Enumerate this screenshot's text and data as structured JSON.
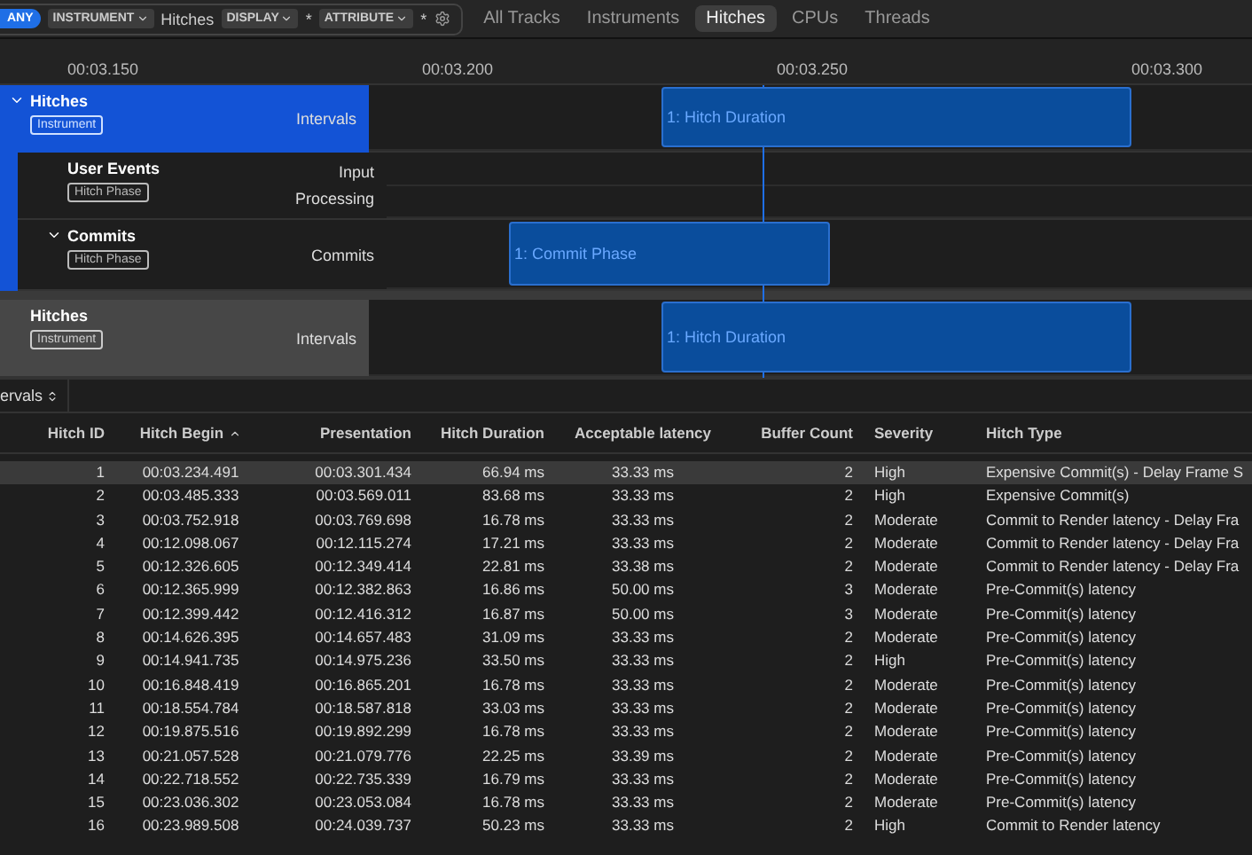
{
  "filter_bar": {
    "any_label": "ANY",
    "tokens": [
      {
        "label": "INSTRUMENT",
        "value": "Hitches"
      },
      {
        "label": "DISPLAY",
        "value": "*"
      },
      {
        "label": "ATTRIBUTE",
        "value": "*"
      }
    ]
  },
  "scope_tabs": [
    {
      "label": "All Tracks",
      "selected": false
    },
    {
      "label": "Instruments",
      "selected": false
    },
    {
      "label": "Hitches",
      "selected": true
    },
    {
      "label": "CPUs",
      "selected": false
    },
    {
      "label": "Threads",
      "selected": false
    }
  ],
  "ruler": {
    "ticks": [
      "00:03.150",
      "00:03.200",
      "00:03.250",
      "00:03.300"
    ]
  },
  "tracks": [
    {
      "name": "Hitches",
      "badge": "Instrument",
      "selected": true,
      "expanded": true,
      "lanes": [
        {
          "label": "Intervals",
          "bars": [
            "1: Hitch Duration"
          ]
        }
      ],
      "children": [
        {
          "name": "User Events",
          "badge": "Hitch Phase",
          "lanes": [
            {
              "label": "Input"
            },
            {
              "label": "Processing"
            }
          ]
        },
        {
          "name": "Commits",
          "badge": "Hitch Phase",
          "expanded": true,
          "lanes": [
            {
              "label": "Commits",
              "bars": [
                "1: Commit Phase"
              ]
            }
          ]
        }
      ]
    },
    {
      "name": "Hitches",
      "badge": "Instrument",
      "selected": false,
      "lanes": [
        {
          "label": "Intervals",
          "bars": [
            "1: Hitch Duration"
          ]
        }
      ]
    }
  ],
  "detail_selector": "ervals",
  "table": {
    "columns": [
      "Hitch ID",
      "Hitch Begin",
      "Presentation",
      "Hitch Duration",
      "Acceptable latency",
      "Buffer Count",
      "Severity",
      "Hitch Type"
    ],
    "rows": [
      {
        "selected": true,
        "cells": [
          "1",
          "00:03.234.491",
          "00:03.301.434",
          "66.94 ms",
          "33.33 ms",
          "2",
          "High",
          "Expensive Commit(s) - Delay Frame S"
        ]
      },
      {
        "selected": false,
        "cells": [
          "2",
          "00:03.485.333",
          "00:03.569.011",
          "83.68 ms",
          "33.33 ms",
          "2",
          "High",
          "Expensive Commit(s)"
        ]
      },
      {
        "selected": false,
        "cells": [
          "3",
          "00:03.752.918",
          "00:03.769.698",
          "16.78 ms",
          "33.33 ms",
          "2",
          "Moderate",
          "Commit to Render latency - Delay Fra"
        ]
      },
      {
        "selected": false,
        "cells": [
          "4",
          "00:12.098.067",
          "00:12.115.274",
          "17.21 ms",
          "33.33 ms",
          "2",
          "Moderate",
          "Commit to Render latency - Delay Fra"
        ]
      },
      {
        "selected": false,
        "cells": [
          "5",
          "00:12.326.605",
          "00:12.349.414",
          "22.81 ms",
          "33.38 ms",
          "2",
          "Moderate",
          "Commit to Render latency - Delay Fra"
        ]
      },
      {
        "selected": false,
        "cells": [
          "6",
          "00:12.365.999",
          "00:12.382.863",
          "16.86 ms",
          "50.00 ms",
          "3",
          "Moderate",
          "Pre-Commit(s) latency"
        ]
      },
      {
        "selected": false,
        "cells": [
          "7",
          "00:12.399.442",
          "00:12.416.312",
          "16.87 ms",
          "50.00 ms",
          "3",
          "Moderate",
          "Pre-Commit(s) latency"
        ]
      },
      {
        "selected": false,
        "cells": [
          "8",
          "00:14.626.395",
          "00:14.657.483",
          "31.09 ms",
          "33.33 ms",
          "2",
          "Moderate",
          "Pre-Commit(s) latency"
        ]
      },
      {
        "selected": false,
        "cells": [
          "9",
          "00:14.941.735",
          "00:14.975.236",
          "33.50 ms",
          "33.33 ms",
          "2",
          "High",
          "Pre-Commit(s) latency"
        ]
      },
      {
        "selected": false,
        "cells": [
          "10",
          "00:16.848.419",
          "00:16.865.201",
          "16.78 ms",
          "33.33 ms",
          "2",
          "Moderate",
          "Pre-Commit(s) latency"
        ]
      },
      {
        "selected": false,
        "cells": [
          "11",
          "00:18.554.784",
          "00:18.587.818",
          "33.03 ms",
          "33.33 ms",
          "2",
          "Moderate",
          "Pre-Commit(s) latency"
        ]
      },
      {
        "selected": false,
        "cells": [
          "12",
          "00:19.875.516",
          "00:19.892.299",
          "16.78 ms",
          "33.33 ms",
          "2",
          "Moderate",
          "Pre-Commit(s) latency"
        ]
      },
      {
        "selected": false,
        "cells": [
          "13",
          "00:21.057.528",
          "00:21.079.776",
          "22.25 ms",
          "33.39 ms",
          "2",
          "Moderate",
          "Pre-Commit(s) latency"
        ]
      },
      {
        "selected": false,
        "cells": [
          "14",
          "00:22.718.552",
          "00:22.735.339",
          "16.79 ms",
          "33.33 ms",
          "2",
          "Moderate",
          "Pre-Commit(s) latency"
        ]
      },
      {
        "selected": false,
        "cells": [
          "15",
          "00:23.036.302",
          "00:23.053.084",
          "16.78 ms",
          "33.33 ms",
          "2",
          "Moderate",
          "Pre-Commit(s) latency"
        ]
      },
      {
        "selected": false,
        "cells": [
          "16",
          "00:23.989.508",
          "00:24.039.737",
          "50.23 ms",
          "33.33 ms",
          "2",
          "High",
          "Commit to Render latency"
        ]
      }
    ]
  }
}
